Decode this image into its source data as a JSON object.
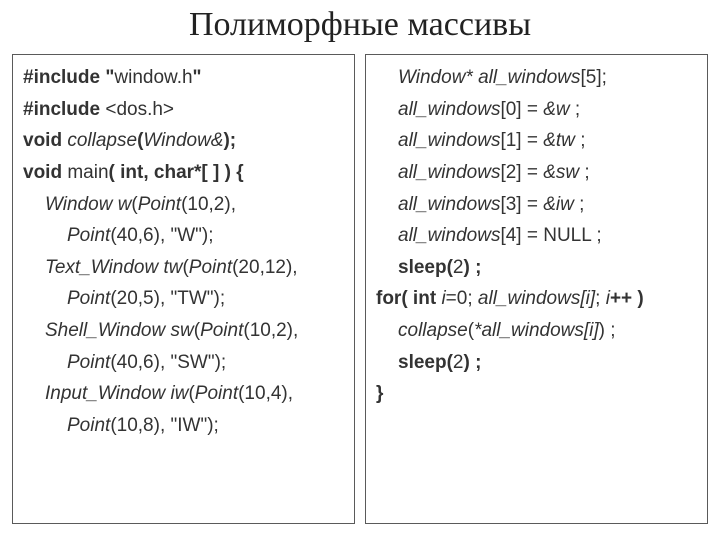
{
  "title": "Полиморфные массивы",
  "left": {
    "l1a": "#include \"",
    "l1b": "window.h",
    "l1c": "\"",
    "l2a": "#include ",
    "l2b": "<dos.h>",
    "l3a": "void ",
    "l3b": "collapse",
    "l3c": "(",
    "l3d": "Window&",
    "l3e": ");",
    "l4a": "void ",
    "l4b": "main",
    "l4c": "( int, char*[ ] ) {",
    "l5a": "Window w",
    "l5b": "(",
    "l5c": "Point",
    "l5d": "(10,2), ",
    "l5e": "Point",
    "l5f": "(40,6), \"W\");",
    "l6a": "Text_Window tw",
    "l6b": "(",
    "l6c": "Point",
    "l6d": "(20,12), ",
    "l6e": "Point",
    "l6f": "(20,5), \"TW\");",
    "l7a": "Shell_Window sw",
    "l7b": "(",
    "l7c": "Point",
    "l7d": "(10,2), ",
    "l7e": "Point",
    "l7f": "(40,6), \"SW\");",
    "l8a": "Input_Window iw",
    "l8b": "(",
    "l8c": "Point",
    "l8d": "(10,4), ",
    "l8e": "Point",
    "l8f": "(10,8), \"IW\");"
  },
  "right": {
    "r1a": "Window* all_windows",
    "r1b": "[5];",
    "r2a": "all_windows",
    "r2b": "[0] = ",
    "r2c": "&w",
    "r2d": " ;",
    "r3a": "all_windows",
    "r3b": "[1] = ",
    "r3c": "&tw",
    "r3d": " ;",
    "r4a": "all_windows",
    "r4b": "[2] = ",
    "r4c": "&sw",
    "r4d": " ;",
    "r5a": "all_windows",
    "r5b": "[3] = ",
    "r5c": "&iw",
    "r5d": " ;",
    "r6a": "all_windows",
    "r6b": "[4] = NULL ;",
    "r7a": "sleep(",
    "r7b": "2",
    "r7c": ") ;",
    "r8a": "for( int ",
    "r8b": "i",
    "r8c": "=0; ",
    "r8d": "all_windows[i]",
    "r8e": "; ",
    "r8f": "i",
    "r8g": "++ )",
    "r9a": "collapse",
    "r9b": "(",
    "r9c": "*all_windows[i]",
    "r9d": ") ;",
    "r10a": "sleep(",
    "r10b": "2",
    "r10c": ") ;",
    "r11": "}"
  }
}
